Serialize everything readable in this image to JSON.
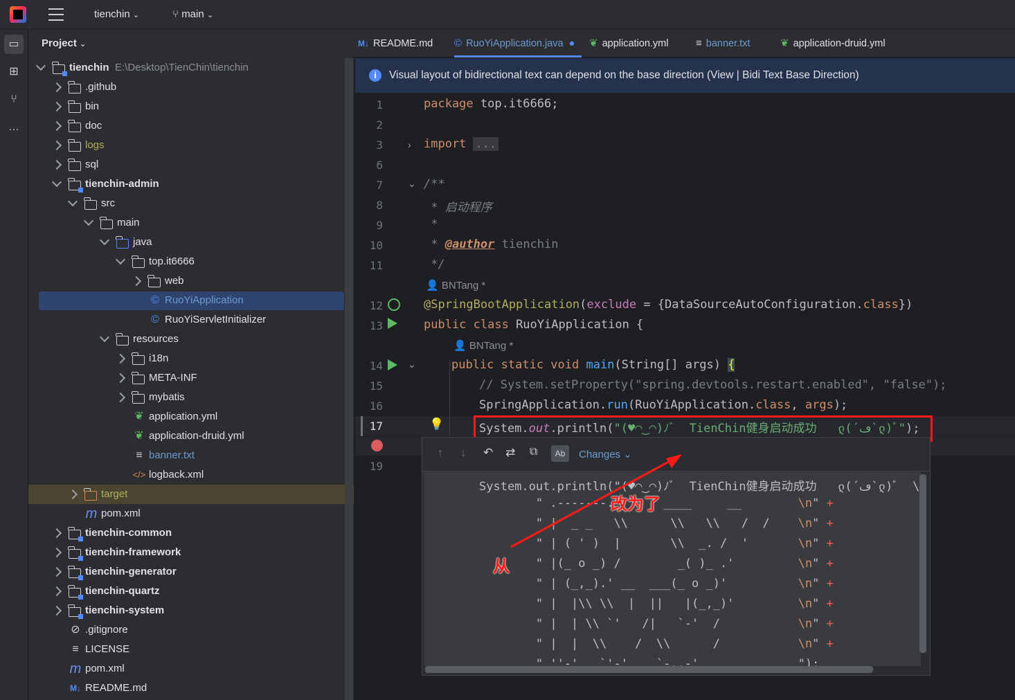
{
  "titlebar": {
    "project": "tienchin",
    "branch": "main"
  },
  "project_panel": {
    "title": "Project",
    "rows": [
      {
        "label": "tienchin",
        "path": "E:\\Desktop\\TienChin\\tienchin",
        "depth": 0,
        "chev": "d",
        "icon": "module",
        "bold": true
      },
      {
        "label": ".github",
        "depth": 1,
        "chev": "r",
        "icon": "folder"
      },
      {
        "label": "bin",
        "depth": 1,
        "chev": "r",
        "icon": "folder"
      },
      {
        "label": "doc",
        "depth": 1,
        "chev": "r",
        "icon": "folder"
      },
      {
        "label": "logs",
        "depth": 1,
        "chev": "r",
        "icon": "folder",
        "color": "#b3ae60"
      },
      {
        "label": "sql",
        "depth": 1,
        "chev": "r",
        "icon": "folder"
      },
      {
        "label": "tienchin-admin",
        "depth": 1,
        "chev": "d",
        "icon": "module",
        "bold": true
      },
      {
        "label": "src",
        "depth": 2,
        "chev": "d",
        "icon": "folder"
      },
      {
        "label": "main",
        "depth": 3,
        "chev": "d",
        "icon": "folder"
      },
      {
        "label": "java",
        "depth": 4,
        "chev": "d",
        "icon": "folder-blue"
      },
      {
        "label": "top.it6666",
        "depth": 5,
        "chev": "d",
        "icon": "package"
      },
      {
        "label": "web",
        "depth": 6,
        "chev": "r",
        "icon": "package"
      },
      {
        "label": "RuoYiApplication",
        "depth": 6,
        "icon": "class-run",
        "color": "#6c9bd2",
        "selected": true
      },
      {
        "label": "RuoYiServletInitializer",
        "depth": 6,
        "icon": "class"
      },
      {
        "label": "resources",
        "depth": 4,
        "chev": "d",
        "icon": "resources"
      },
      {
        "label": "i18n",
        "depth": 5,
        "chev": "r",
        "icon": "folder"
      },
      {
        "label": "META-INF",
        "depth": 5,
        "chev": "r",
        "icon": "folder"
      },
      {
        "label": "mybatis",
        "depth": 5,
        "chev": "r",
        "icon": "folder"
      },
      {
        "label": "application.yml",
        "depth": 5,
        "icon": "spring"
      },
      {
        "label": "application-druid.yml",
        "depth": 5,
        "icon": "spring"
      },
      {
        "label": "banner.txt",
        "depth": 5,
        "icon": "text",
        "color": "#6c9bd2"
      },
      {
        "label": "logback.xml",
        "depth": 5,
        "icon": "xml"
      },
      {
        "label": "target",
        "depth": 2,
        "chev": "r",
        "icon": "folder-orange",
        "color": "#b3ae60",
        "excluded": true
      },
      {
        "label": "pom.xml",
        "depth": 2,
        "icon": "maven"
      },
      {
        "label": "tienchin-common",
        "depth": 1,
        "chev": "r",
        "icon": "module",
        "bold": true
      },
      {
        "label": "tienchin-framework",
        "depth": 1,
        "chev": "r",
        "icon": "module",
        "bold": true
      },
      {
        "label": "tienchin-generator",
        "depth": 1,
        "chev": "r",
        "icon": "module",
        "bold": true
      },
      {
        "label": "tienchin-quartz",
        "depth": 1,
        "chev": "r",
        "icon": "module",
        "bold": true
      },
      {
        "label": "tienchin-system",
        "depth": 1,
        "chev": "r",
        "icon": "module",
        "bold": true
      },
      {
        "label": ".gitignore",
        "depth": 1,
        "icon": "ignore"
      },
      {
        "label": "LICENSE",
        "depth": 1,
        "icon": "text"
      },
      {
        "label": "pom.xml",
        "depth": 1,
        "icon": "maven"
      },
      {
        "label": "README.md",
        "depth": 1,
        "icon": "markdown"
      }
    ]
  },
  "tabs": [
    {
      "label": "README.md",
      "icon": "markdown"
    },
    {
      "label": "RuoYiApplication.java",
      "icon": "class-run",
      "active": true,
      "modified": true
    },
    {
      "label": "application.yml",
      "icon": "spring"
    },
    {
      "label": "banner.txt",
      "icon": "text"
    },
    {
      "label": "application-druid.yml",
      "icon": "spring"
    }
  ],
  "banner_text": "Visual layout of bidirectional text can depend on the base direction (View | Bidi Text Base Direction)",
  "line_numbers": [
    "1",
    "2",
    "3",
    "6",
    "7",
    "8",
    "9",
    "10",
    "11",
    "12",
    "13",
    "14",
    "15",
    "16",
    "17",
    "19"
  ],
  "code": {
    "l1_kw": "package",
    "l1_rest": " top.it6666;",
    "l3_kw": "import",
    "l3_rest": "...",
    "l7": "/**",
    "l8": " * 启动程序",
    "l9": " *",
    "l10_pre": " * ",
    "l10_tag": "@author",
    "l10_rest": " tienchin",
    "l11": " */",
    "author_hint": "BNTang *",
    "l12_ann": "@SpringBootApplication",
    "l12_a": "(",
    "l12_param": "exclude",
    "l12_b": " = {DataSourceAutoConfiguration.",
    "l12_kw": "class",
    "l12_c": "})",
    "l13_kw": "public class",
    "l13_rest": " RuoYiApplication {",
    "l14_kw": "public static void",
    "l14_fn": " main",
    "l14_a": "(String[] ",
    "l14_param": "args",
    "l14_b": ") ",
    "l14_brace": "{",
    "l15": "// System.setProperty(\"spring.devtools.restart.enabled\", \"false\");",
    "l16_a": "SpringApplication.",
    "l16_fn": "run",
    "l16_b": "(RuoYiApplication.",
    "l16_kw": "class",
    "l16_c": ", ",
    "l16_param": "args",
    "l16_d": ");",
    "l17_a": "System.",
    "l17_out": "out",
    "l17_b": ".println(",
    "l17_str": "\"(♥◠‿◠)ﾉﾞ  TienChin健身启动成功   ლ(´ڡ`ლ)ﾞ\"",
    "l17_c": ");"
  },
  "diff_popup": {
    "changes_label": "Changes",
    "lines": [
      "System.out.println(\"(♥◠‿◠)ﾉﾞ  TienChin健身启动成功   ლ(´ڡ`ლ)ﾞ  \\",
      "        \" .-------.       ____     __        \\n\" +",
      "        \" |  _ _   \\\\      \\\\   \\\\   /  /    \\n\" +",
      "        \" | ( ' )  |       \\\\  _. /  '       \\n\" +",
      "        \" |(_ o _) /        _( )_ .'         \\n\" +",
      "        \" | (_,_).' __  ___(_ o _)'          \\n\" +",
      "        \" |  |\\\\ \\\\  |  ||   |(_,_)'         \\n\" +",
      "        \" |  | \\\\ `'   /|   `-'  /           \\n\" +",
      "        \" |  |  \\\\    /  \\\\      /           \\n\" +",
      "        \" ''-'   `'-'    `-..-'              \");"
    ]
  },
  "annotations": {
    "from": "从",
    "to": "改为了"
  },
  "colors": {
    "annotation_red": "#ff1a1a",
    "selection": "#2e436e"
  }
}
